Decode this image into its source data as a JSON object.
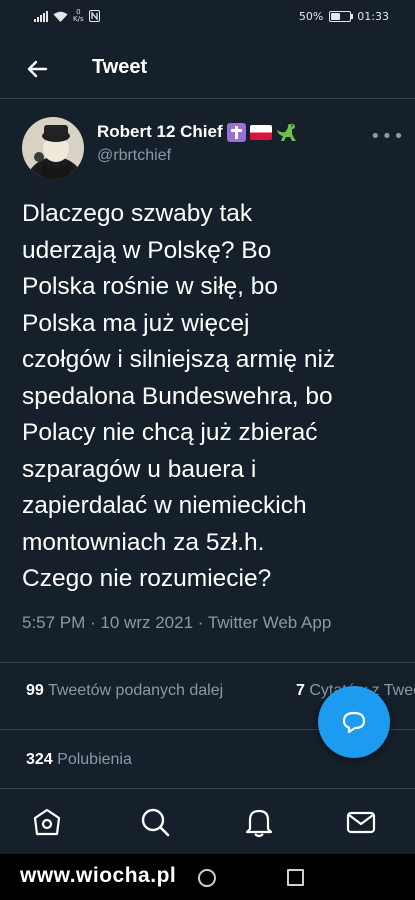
{
  "status_bar": {
    "speed_value": "0",
    "speed_unit": "K/s",
    "battery_percent": "50%",
    "battery_level": 0.5,
    "time": "01:33"
  },
  "header": {
    "title": "Tweet"
  },
  "tweet": {
    "author_name": "Robert 12 Chief",
    "author_handle": "@rbrtchief",
    "text": "Dlaczego szwaby tak\nuderzają w Polskę? Bo\nPolska rośnie w siłę, bo\nPolska ma już więcej\nczołgów i silniejszą armię niż\nspedalona Bundeswehra, bo\nPolacy nie chcą już zbierać\nszparagów u bauera i\nzapierdalać w niemieckich\nmontowniach za 5zł.h.\nCzego nie rozumiecie?",
    "meta": "5:57 PM · 10 wrz 2021 · Twitter Web App",
    "more_label": "•••"
  },
  "stats": {
    "retweets_count": "99",
    "retweets_label": "Tweetów podanych dalej",
    "quotes_count": "7",
    "quotes_label": "Cytatów z Tweeta",
    "likes_count": "324",
    "likes_label": "Polubienia"
  },
  "tab_bar": {
    "icons": [
      "home-icon",
      "search-icon",
      "notifications-icon",
      "messages-icon"
    ]
  },
  "watermark": "www.wiocha.pl",
  "colors": {
    "background": "#15202b",
    "accent": "#1d9bf0",
    "secondary_text": "#8b98a5",
    "divider": "#38444d"
  }
}
